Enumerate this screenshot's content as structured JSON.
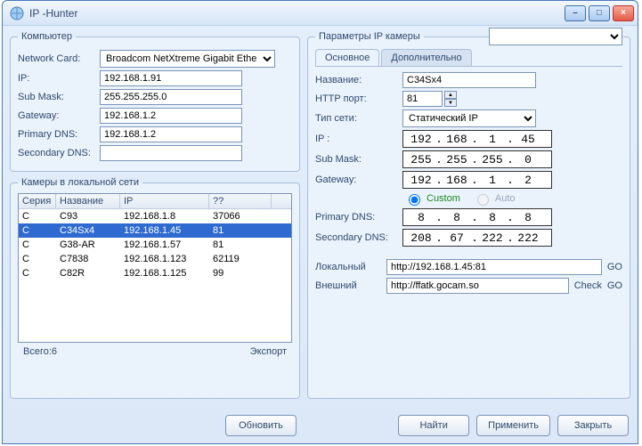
{
  "title": "IP  -Hunter",
  "winbtns": {
    "min": "–",
    "max": "□",
    "close": "×"
  },
  "computer": {
    "legend": "Компьютер",
    "netcard_label": "Network Card:",
    "netcard_options": [
      "Broadcom NetXtreme Gigabit Ethe"
    ],
    "netcard_value": "Broadcom NetXtreme Gigabit Ethe",
    "ip_label": "IP:",
    "ip": "192.168.1.91",
    "mask_label": "Sub Mask:",
    "mask": "255.255.255.0",
    "gw_label": "Gateway:",
    "gw": "192.168.1.2",
    "pdns_label": "Primary DNS:",
    "pdns": "192.168.1.2",
    "sdns_label": "Secondary DNS:",
    "sdns": ""
  },
  "lan": {
    "legend": "Камеры в локальной сети",
    "cols": [
      "Серия",
      "Название",
      "IP",
      "??"
    ],
    "rows": [
      {
        "s": "C",
        "n": "C93",
        "ip": "192.168.1.8",
        "p": "37066",
        "sel": false
      },
      {
        "s": "C",
        "n": "C34Sx4",
        "ip": "192.168.1.45",
        "p": "81",
        "sel": true
      },
      {
        "s": "C",
        "n": "G38-AR",
        "ip": "192.168.1.57",
        "p": "81",
        "sel": false
      },
      {
        "s": "C",
        "n": "C7838",
        "ip": "192.168.1.123",
        "p": "62119",
        "sel": false
      },
      {
        "s": "C",
        "n": "C82R",
        "ip": "192.168.1.125",
        "p": "99",
        "sel": false
      }
    ],
    "total_label": "Всего:6",
    "export_label": "Экспорт"
  },
  "params": {
    "legend": "Параметры IP камеры",
    "camera_select": "",
    "tabs": {
      "main": "Основное",
      "adv": "Дополнительно"
    },
    "name_label": "Название:",
    "name": "C34Sx4",
    "port_label": "HTTP порт:",
    "port": "81",
    "nettype_label": "Тип сети:",
    "nettype_value": "Статический IP",
    "nettype_options": [
      "Статический IP"
    ],
    "ip_label": "IP :",
    "ip": [
      "192",
      "168",
      "1",
      "45"
    ],
    "mask_label": "Sub Mask:",
    "mask": [
      "255",
      "255",
      "255",
      "0"
    ],
    "gw_label": "Gateway:",
    "gw": [
      "192",
      "168",
      "1",
      "2"
    ],
    "custom": "Custom",
    "auto": "Auto",
    "pdns_label": "Primary DNS:",
    "pdns": [
      "8",
      "8",
      "8",
      "8"
    ],
    "sdns_label": "Secondary DNS:",
    "sdns": [
      "208",
      "67",
      "222",
      "222"
    ],
    "local_label": "Локальный",
    "local_url": "http://192.168.1.45:81",
    "ext_label": "Внешний",
    "ext_url": "http://ffatk.gocam.so",
    "go": "GO",
    "check": "Check"
  },
  "footer": {
    "refresh": "Обновить",
    "find": "Найти",
    "apply": "Применить",
    "close": "Закрыть"
  }
}
